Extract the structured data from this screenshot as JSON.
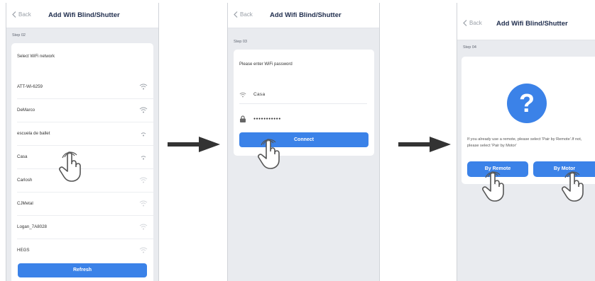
{
  "common": {
    "back_label": "Back",
    "title": "Add Wifi Blind/Shutter"
  },
  "step2": {
    "step_label": "Step 02",
    "prompt": "Select WiFi network",
    "networks": [
      "ATT-Wi-6259",
      "DeMarco",
      "escuela de ballet",
      "Casa",
      "Carlosh",
      "CJMetal",
      "Logan_7A8028",
      "HEGS"
    ],
    "refresh_label": "Refresh"
  },
  "step3": {
    "step_label": "Step 03",
    "prompt": "Please enter WiFi password",
    "ssid_value": "Casa",
    "password_value": "●●●●●●●●●●●",
    "connect_label": "Connect"
  },
  "step4": {
    "step_label": "Step 04",
    "question_mark": "?",
    "info": "If you already use a remote, please select 'Pair by Remote'.If not, please select 'Pair by Motor'",
    "remote_label": "By Remote",
    "motor_label": "By Motor"
  },
  "colors": {
    "accent": "#3b82e8",
    "title": "#1f2d4d",
    "background": "#e9ebef"
  },
  "icons": [
    "chevron-left-icon",
    "wifi-icon",
    "lock-icon",
    "question-icon",
    "hand-pointer-icon",
    "arrow-right-icon"
  ]
}
